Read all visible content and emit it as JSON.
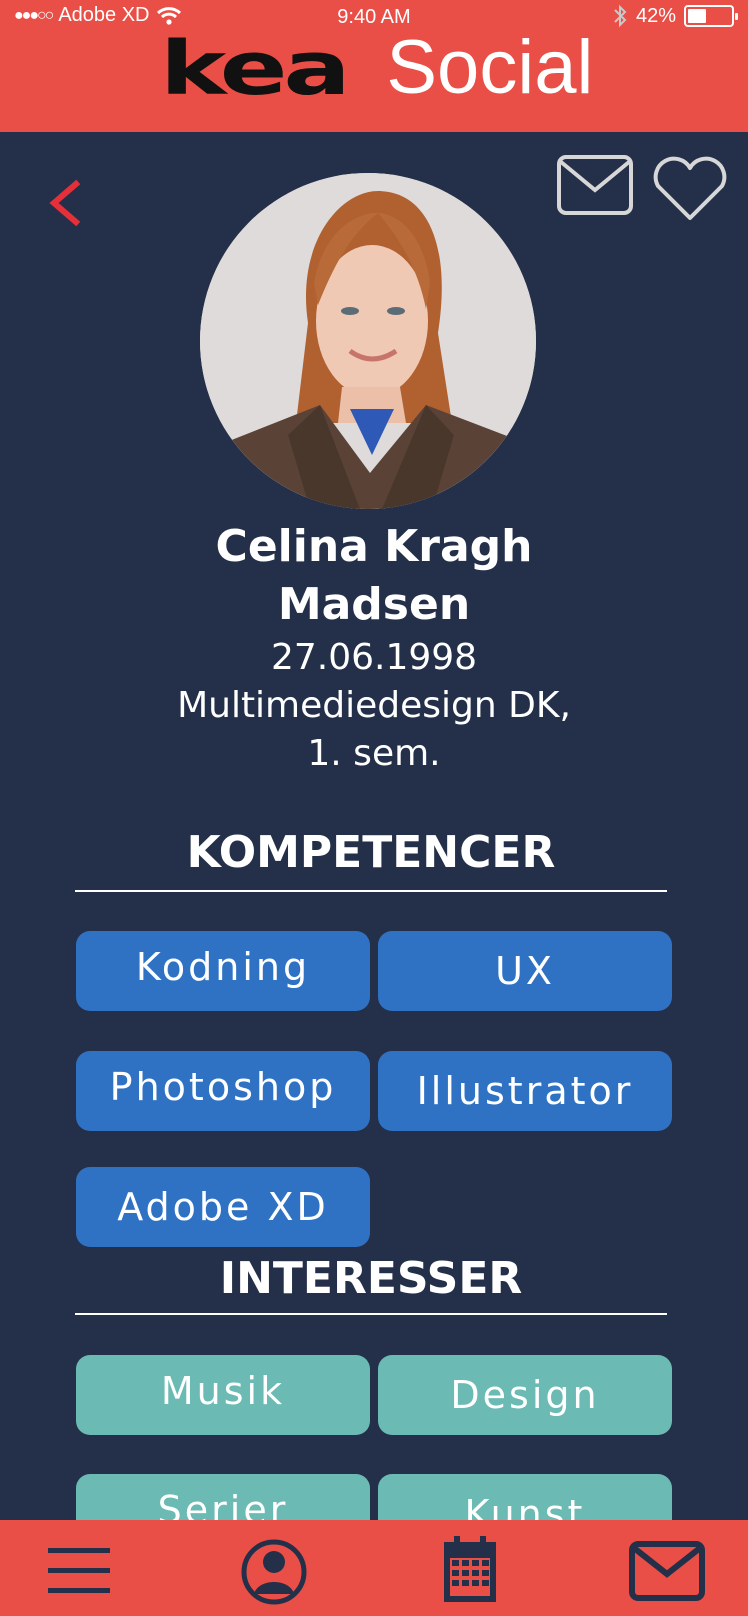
{
  "status_bar": {
    "carrier": "Adobe XD",
    "time": "9:40 AM",
    "battery": "42%",
    "battery_level": 0.42
  },
  "header": {
    "logo_text": "kea",
    "title": "Social"
  },
  "profile": {
    "name_line1": "Celina Kragh",
    "name_line2": "Madsen",
    "birthdate": "27.06.1998",
    "program_line1": "Multimediedesign DK,",
    "program_line2": "1. sem."
  },
  "competences": {
    "title": "KOMPETENCER",
    "items": [
      "Kodning",
      "UX",
      "Photoshop",
      "Illustrator",
      "Adobe XD"
    ]
  },
  "interests": {
    "title": "INTERESSER",
    "items": [
      "Musik",
      "Design",
      "Serier",
      "Kunst"
    ]
  },
  "icons": {
    "back": "chevron-left-icon",
    "mail": "mail-icon",
    "favorite": "heart-icon",
    "menu": "menu-icon",
    "profile": "user-icon",
    "calendar": "calendar-icon",
    "messages": "mail-icon"
  },
  "colors": {
    "header_bg": "#e94f46",
    "page_bg": "#243049",
    "competence_chip": "#2f72c4",
    "interest_chip": "#6bbab3",
    "back_arrow": "#e5303a"
  }
}
